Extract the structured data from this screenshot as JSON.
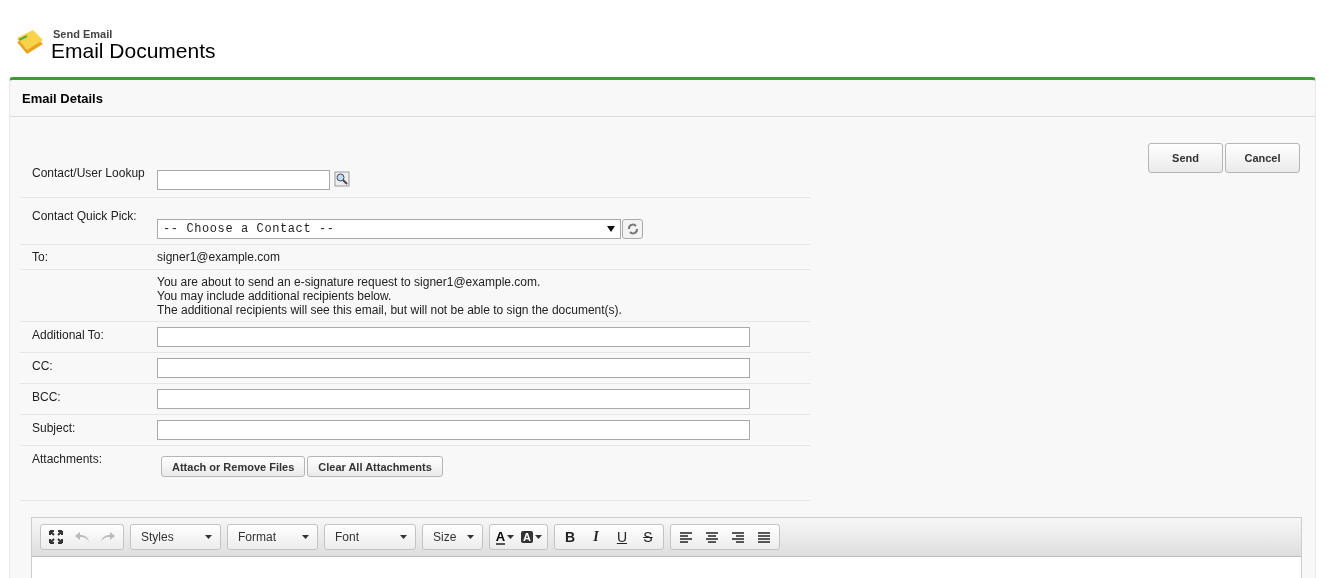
{
  "header": {
    "subtitle": "Send Email",
    "title": "Email Documents"
  },
  "panel": {
    "title": "Email Details"
  },
  "actions": [
    "Send",
    "Cancel"
  ],
  "lookup": {
    "label": "Contact/User Lookup"
  },
  "quick_pick": {
    "label": "Contact Quick Pick:",
    "value": "-- Choose a Contact --"
  },
  "to": {
    "label": "To:",
    "value": "signer1@example.com"
  },
  "notice": [
    "You are about to send an e-signature request to signer1@example.com.",
    "You may include additional recipients below.",
    "The additional recipients will see this email, but will not be able to sign the document(s)."
  ],
  "fields": [
    {
      "label": "Additional To:"
    },
    {
      "label": "CC:"
    },
    {
      "label": "BCC:"
    },
    {
      "label": "Subject:"
    }
  ],
  "attachments": {
    "label": "Attachments:",
    "buttons": [
      "Attach or Remove Files",
      "Clear All Attachments"
    ]
  },
  "editor": {
    "undo_disabled": true,
    "redo_disabled": true,
    "dropdowns": [
      {
        "label": "Styles"
      },
      {
        "label": "Format"
      },
      {
        "label": "Font"
      },
      {
        "label": "Size"
      }
    ],
    "color_buttons": [
      {
        "kind": "text",
        "label": "A"
      },
      {
        "kind": "background",
        "label": "A"
      }
    ],
    "format_buttons": [
      {
        "kind": "bold",
        "label": "B"
      },
      {
        "kind": "italic",
        "label": "I"
      },
      {
        "kind": "underline",
        "label": "U"
      },
      {
        "kind": "strike",
        "label": "S"
      }
    ],
    "align_buttons": [
      {
        "kind": "left"
      },
      {
        "kind": "center"
      },
      {
        "kind": "right"
      },
      {
        "kind": "justify"
      }
    ]
  }
}
